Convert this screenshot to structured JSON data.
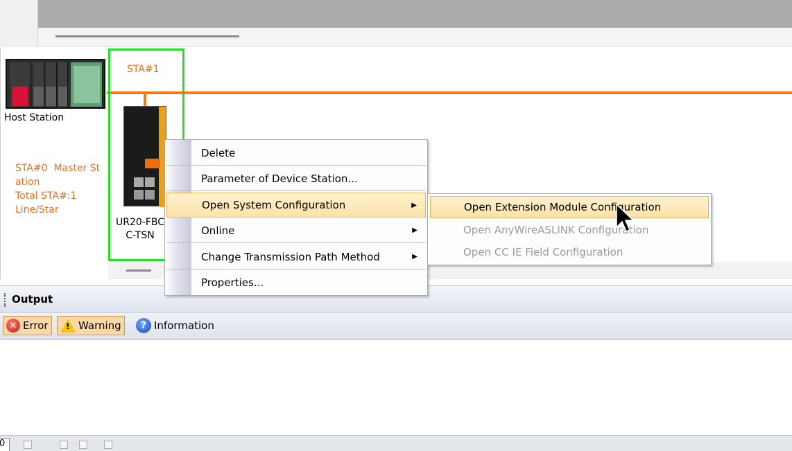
{
  "canvas": {
    "host_label": "Host Station",
    "master_info": [
      "STA#0  Master St",
      "ation",
      "Total STA#:1",
      "Line/Star"
    ],
    "station_label": "STA#1",
    "device_label": [
      "UR20-FBC",
      "C-TSN"
    ]
  },
  "context_menu": {
    "items": [
      {
        "label": "Delete",
        "submenu": false
      },
      {
        "label": "Parameter of Device Station...",
        "submenu": false
      },
      {
        "label": "Open System Configuration",
        "submenu": true
      },
      {
        "label": "Online",
        "submenu": true
      },
      {
        "label": "Change Transmission Path Method",
        "submenu": true
      },
      {
        "label": "Properties...",
        "submenu": false
      }
    ]
  },
  "submenu": {
    "items": [
      {
        "label": "Open Extension Module Configuration",
        "enabled": true
      },
      {
        "label": "Open AnyWireASLINK Configuration",
        "enabled": false
      },
      {
        "label": "Open CC IE Field Configuration",
        "enabled": false
      }
    ]
  },
  "output": {
    "title": "Output",
    "filters": {
      "error": "Error",
      "warning": "Warning",
      "information": "Information"
    }
  },
  "status_bar": {
    "count": "0"
  },
  "colors": {
    "station_orange": "#f07a1a",
    "selection_green": "#22e022",
    "menu_highlight": "#fde2a8"
  }
}
